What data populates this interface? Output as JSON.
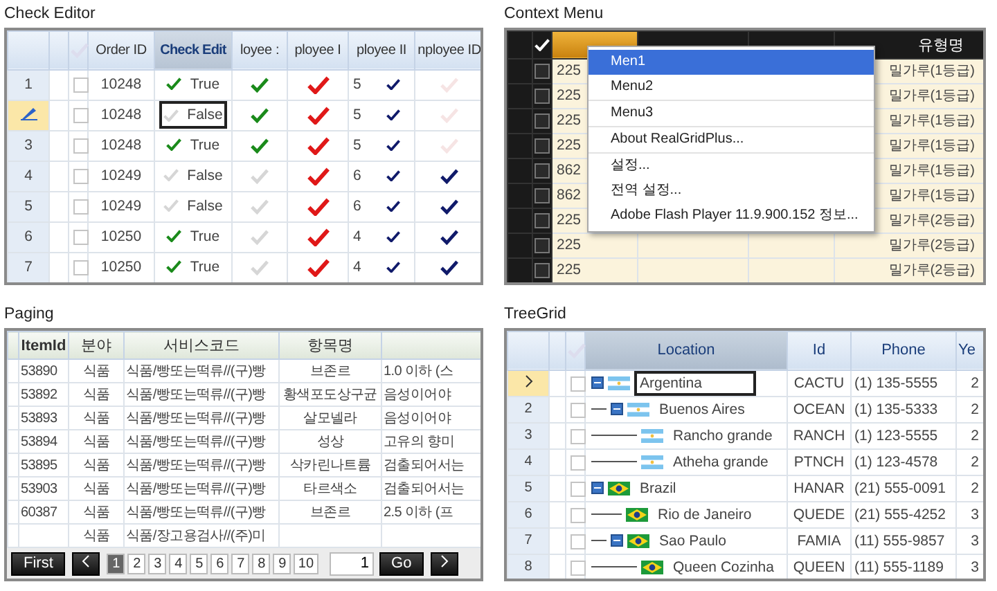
{
  "check_editor": {
    "title": "Check Editor",
    "columns": [
      "Order ID",
      "Check Edit",
      "loyee :",
      "ployee I",
      "ployee II",
      "nployee ID"
    ],
    "rows": [
      {
        "num": "1",
        "editing": false,
        "checked": false,
        "order_id": "10248",
        "check_edit": {
          "checked": true,
          "text": "True",
          "focused": false
        },
        "c5": true,
        "c6": true,
        "c7": {
          "text": "5",
          "checked": true
        },
        "c8": false
      },
      {
        "num": "",
        "editing": true,
        "checked": false,
        "order_id": "10248",
        "check_edit": {
          "checked": false,
          "text": "False",
          "focused": true
        },
        "c5": true,
        "c6": true,
        "c7": {
          "text": "5",
          "checked": true
        },
        "c8": false
      },
      {
        "num": "3",
        "editing": false,
        "checked": false,
        "order_id": "10248",
        "check_edit": {
          "checked": true,
          "text": "True",
          "focused": false
        },
        "c5": true,
        "c6": true,
        "c7": {
          "text": "5",
          "checked": true
        },
        "c8": false
      },
      {
        "num": "4",
        "editing": false,
        "checked": false,
        "order_id": "10249",
        "check_edit": {
          "checked": false,
          "text": "False",
          "focused": false
        },
        "c5": false,
        "c6": true,
        "c7": {
          "text": "6",
          "checked": true
        },
        "c8": true
      },
      {
        "num": "5",
        "editing": false,
        "checked": false,
        "order_id": "10249",
        "check_edit": {
          "checked": false,
          "text": "False",
          "focused": false
        },
        "c5": false,
        "c6": true,
        "c7": {
          "text": "6",
          "checked": true
        },
        "c8": true
      },
      {
        "num": "6",
        "editing": false,
        "checked": false,
        "order_id": "10250",
        "check_edit": {
          "checked": true,
          "text": "True",
          "focused": false
        },
        "c5": false,
        "c6": true,
        "c7": {
          "text": "4",
          "checked": true
        },
        "c8": true
      },
      {
        "num": "7",
        "editing": false,
        "checked": false,
        "order_id": "10250",
        "check_edit": {
          "checked": true,
          "text": "True",
          "focused": false
        },
        "c5": false,
        "c6": true,
        "c7": {
          "text": "4",
          "checked": true
        },
        "c8": true
      }
    ]
  },
  "context_menu_demo": {
    "title": "Context Menu",
    "columns": [
      "",
      "",
      "",
      "유형명"
    ],
    "rows": [
      {
        "checked": false,
        "item_id": "225",
        "type": "밀가루(1등급)"
      },
      {
        "checked": false,
        "item_id": "225",
        "type": "밀가루(1등급)"
      },
      {
        "checked": false,
        "item_id": "225",
        "type": "밀가루(1등급)"
      },
      {
        "checked": false,
        "item_id": "225",
        "type": "밀가루(1등급)"
      },
      {
        "checked": false,
        "item_id": "862",
        "type": "밀가루(1등급)"
      },
      {
        "checked": false,
        "item_id": "862",
        "type": "밀가루(1등급)"
      },
      {
        "checked": false,
        "item_id": "225",
        "type": "밀가루(2등급)"
      },
      {
        "checked": false,
        "item_id": "225",
        "type": "밀가루(2등급)"
      },
      {
        "checked": false,
        "item_id": "225",
        "type": "밀가루(2등급)"
      }
    ],
    "menu": {
      "groups": [
        [
          {
            "label": "Men1",
            "selected": true
          },
          {
            "label": "Menu2",
            "selected": false
          }
        ],
        [
          {
            "label": "Menu3",
            "selected": false
          }
        ],
        [
          {
            "label": "About RealGridPlus...",
            "selected": false
          }
        ],
        [
          {
            "label": "설정...",
            "selected": false
          },
          {
            "label": "전역 설정...",
            "selected": false
          },
          {
            "label": "Adobe Flash Player 11.9.900.152 정보...",
            "selected": false
          }
        ]
      ]
    }
  },
  "paging": {
    "title": "Paging",
    "columns": [
      "ItemId",
      "분야",
      "서비스코드",
      "항목명",
      ""
    ],
    "rows": [
      [
        "53890",
        "식품",
        "식품/빵또는떡류//(구)빵",
        "브존르",
        "1.0 이하 (스"
      ],
      [
        "53892",
        "식품",
        "식품/빵또는떡류//(구)빵",
        "황색포도상구균",
        "음성이어야"
      ],
      [
        "53893",
        "식품",
        "식품/빵또는떡류//(구)빵",
        "살모넬라",
        "음성이어야"
      ],
      [
        "53894",
        "식품",
        "식품/빵또는떡류//(구)빵",
        "성상",
        "고유의 향미"
      ],
      [
        "53895",
        "식품",
        "식품/빵또는떡류//(구)빵",
        "삭카린나트륨",
        "검출되어서는"
      ],
      [
        "53903",
        "식품",
        "식품/빵또는떡류//(구)빵",
        "타르색소",
        "검출되어서는"
      ],
      [
        "60387",
        "식품",
        "식품/빵또는떡류//(구)빵",
        "브존르",
        "2.5 이하 (프"
      ],
      [
        "",
        "식품",
        "식품/장고용검사//(주)미",
        "",
        ""
      ]
    ],
    "pager": {
      "first": "First",
      "pages": [
        {
          "label": "1",
          "selected": true
        },
        {
          "label": "2",
          "selected": false
        },
        {
          "label": "3",
          "selected": false
        },
        {
          "label": "4",
          "selected": false
        },
        {
          "label": "5",
          "selected": false
        },
        {
          "label": "6",
          "selected": false
        },
        {
          "label": "7",
          "selected": false
        },
        {
          "label": "8",
          "selected": false
        },
        {
          "label": "9",
          "selected": false
        },
        {
          "label": "10",
          "selected": false
        }
      ],
      "page_input": "1",
      "go": "Go"
    }
  },
  "tree_grid": {
    "title": "TreeGrid",
    "columns": [
      "Location",
      "Id",
      "Phone",
      "Ye"
    ],
    "rows": [
      {
        "num": "",
        "current": true,
        "checked": false,
        "kind": "argentina",
        "location": "Argentina",
        "focused": true,
        "id": "CACTU",
        "phone": "(1) 135-5555",
        "ye": "2",
        "expanded": true,
        "children": [
          {
            "num": "2",
            "current": false,
            "checked": false,
            "kind": "argentina",
            "location": "Buenos Aires",
            "focused": false,
            "id": "OCEAN",
            "phone": "(1) 135-5333",
            "ye": "2",
            "expanded": true,
            "children": [
              {
                "num": "3",
                "current": false,
                "checked": false,
                "kind": "argentina",
                "location": "Rancho grande",
                "focused": false,
                "id": "RANCH",
                "phone": "(1) 123-5555",
                "ye": "2"
              },
              {
                "num": "4",
                "current": false,
                "checked": false,
                "kind": "argentina",
                "location": "Atheha grande",
                "focused": false,
                "id": "PTNCH",
                "phone": "(1) 123-4578",
                "ye": "2"
              }
            ]
          }
        ]
      },
      {
        "num": "5",
        "current": false,
        "checked": false,
        "kind": "brazil",
        "location": "Brazil",
        "focused": false,
        "id": "HANAR",
        "phone": "(21) 555-0091",
        "ye": "2",
        "expanded": true,
        "children": [
          {
            "num": "6",
            "current": false,
            "checked": false,
            "kind": "brazil",
            "location": "Rio de Janeiro",
            "focused": false,
            "id": "QUEDE",
            "phone": "(21) 555-4252",
            "ye": "3"
          },
          {
            "num": "7",
            "current": false,
            "checked": false,
            "kind": "brazil",
            "location": "Sao Paulo",
            "focused": false,
            "id": "FAMIA",
            "phone": "(11) 555-9857",
            "ye": "3",
            "expanded": true,
            "children": [
              {
                "num": "8",
                "current": false,
                "checked": false,
                "kind": "brazil",
                "location": "Queen Cozinha",
                "focused": false,
                "id": "QUEEN",
                "phone": "(11) 555-1189",
                "ye": "3"
              }
            ]
          }
        ]
      }
    ]
  }
}
